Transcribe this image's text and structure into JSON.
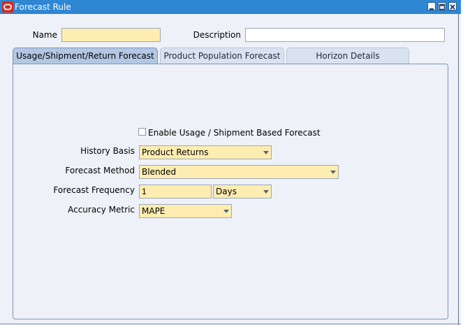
{
  "window": {
    "title": "Forecast Rule",
    "controls": [
      "minimize-icon",
      "maximize-icon",
      "close-icon"
    ]
  },
  "form": {
    "name_label": "Name",
    "name_value": "",
    "description_label": "Description",
    "description_value": ""
  },
  "tabs": [
    {
      "label": "Usage/Shipment/Return Forecast",
      "active": true
    },
    {
      "label": "Product Population Forecast",
      "active": false
    },
    {
      "label": "Horizon Details",
      "active": false
    }
  ],
  "usage_tab": {
    "enable_checkbox_label": "Enable Usage / Shipment Based Forecast",
    "enable_checked": false,
    "history_basis_label": "History Basis",
    "history_basis_value": "Product Returns",
    "forecast_method_label": "Forecast Method",
    "forecast_method_value": "Blended",
    "forecast_frequency_label": "Forecast Frequency",
    "forecast_frequency_value": "1",
    "forecast_frequency_unit": "Days",
    "accuracy_metric_label": "Accuracy Metric",
    "accuracy_metric_value": "MAPE"
  },
  "colors": {
    "titlebar": "#2f86d2",
    "required_field": "#fdedb1",
    "background": "#eef1f7",
    "active_tab": "#b2c7e3",
    "inactive_tab": "#d9e2f0",
    "oracle_red": "#d52b1e"
  }
}
